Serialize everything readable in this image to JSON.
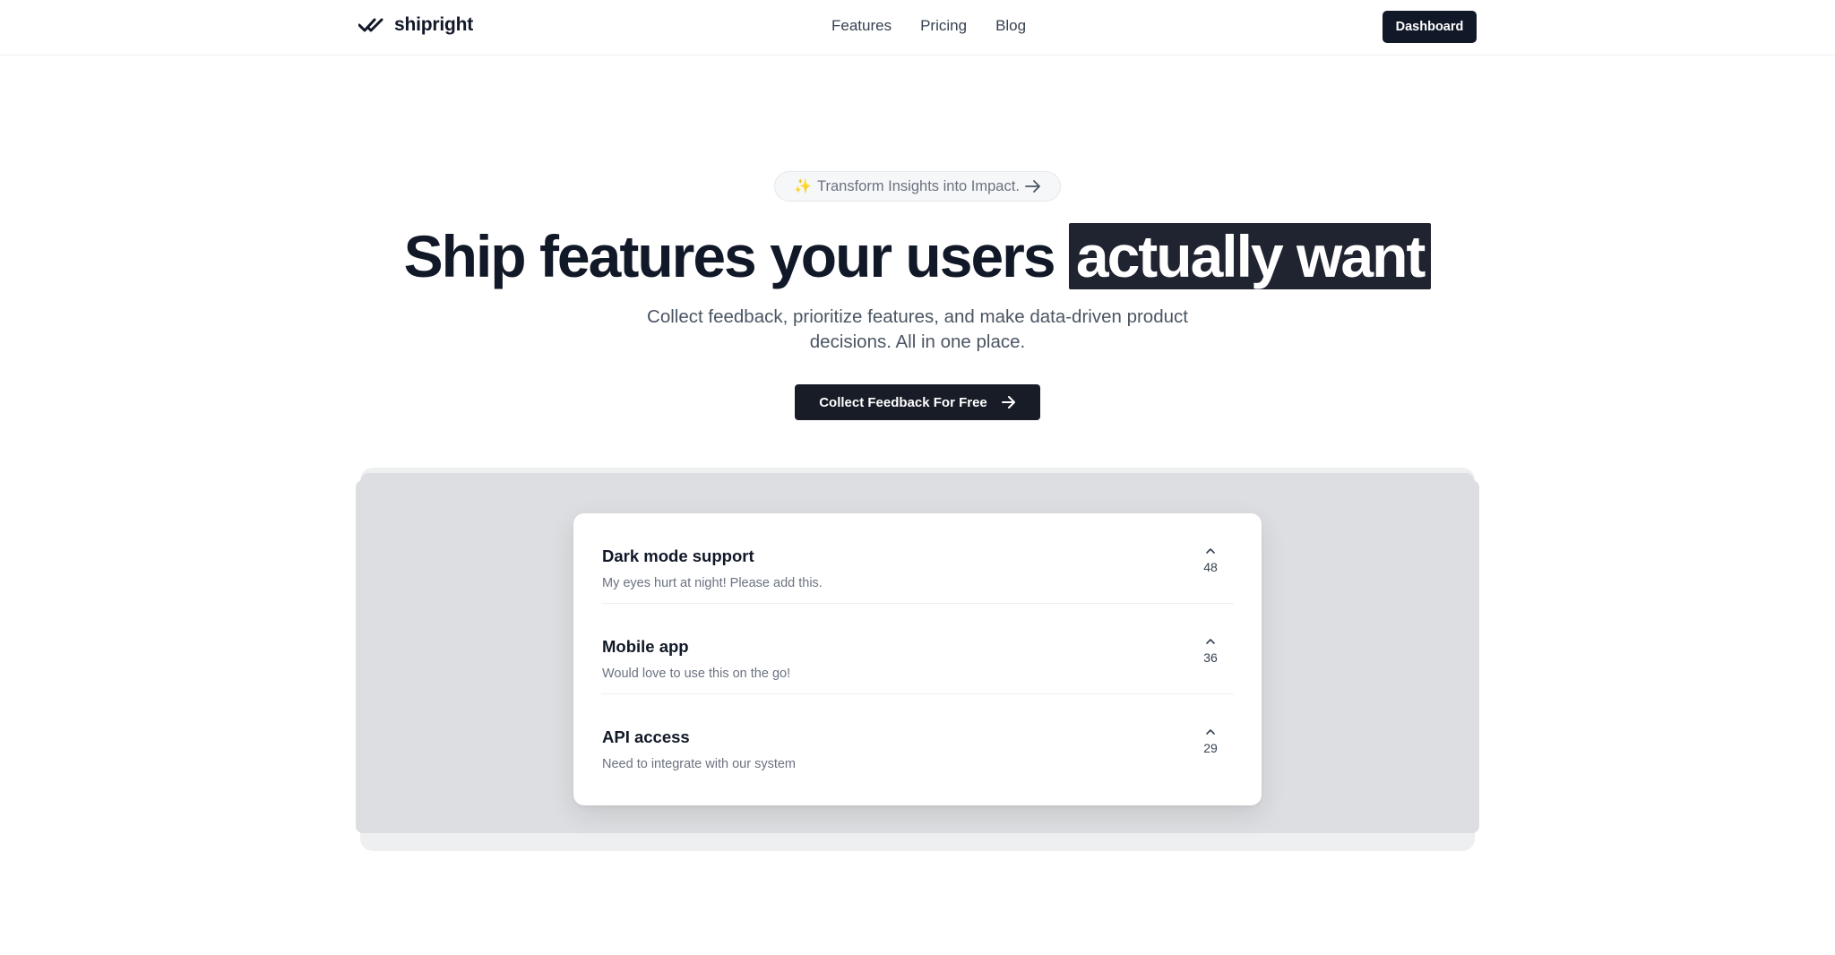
{
  "nav": {
    "brand": "shipright",
    "links": [
      "Features",
      "Pricing",
      "Blog"
    ],
    "dashboard_label": "Dashboard"
  },
  "hero": {
    "pill_text": "Transform Insights into Impact.",
    "headline_main": "Ship features your users ",
    "headline_highlight": "actually want",
    "subtitle_line1": "Collect feedback, prioritize features, and make data-driven product",
    "subtitle_line2": "decisions. All in one place.",
    "cta_label": "Collect Feedback For Free"
  },
  "feedback": [
    {
      "title": "Dark mode support",
      "description": "My eyes hurt at night! Please add this.",
      "votes": "48"
    },
    {
      "title": "Mobile app",
      "description": "Would love to use this on the go!",
      "votes": "36"
    },
    {
      "title": "API access",
      "description": "Need to integrate with our system",
      "votes": "29"
    }
  ],
  "colors": {
    "primary": "#111827",
    "highlight_bg": "#1f2430",
    "text_muted": "#6b7280"
  },
  "icons": {
    "logo": "double-check-icon",
    "pill_prefix": "sparkles-icon",
    "pill_suffix": "arrow-right-icon",
    "cta_suffix": "arrow-right-icon",
    "vote": "chevron-up-icon"
  }
}
